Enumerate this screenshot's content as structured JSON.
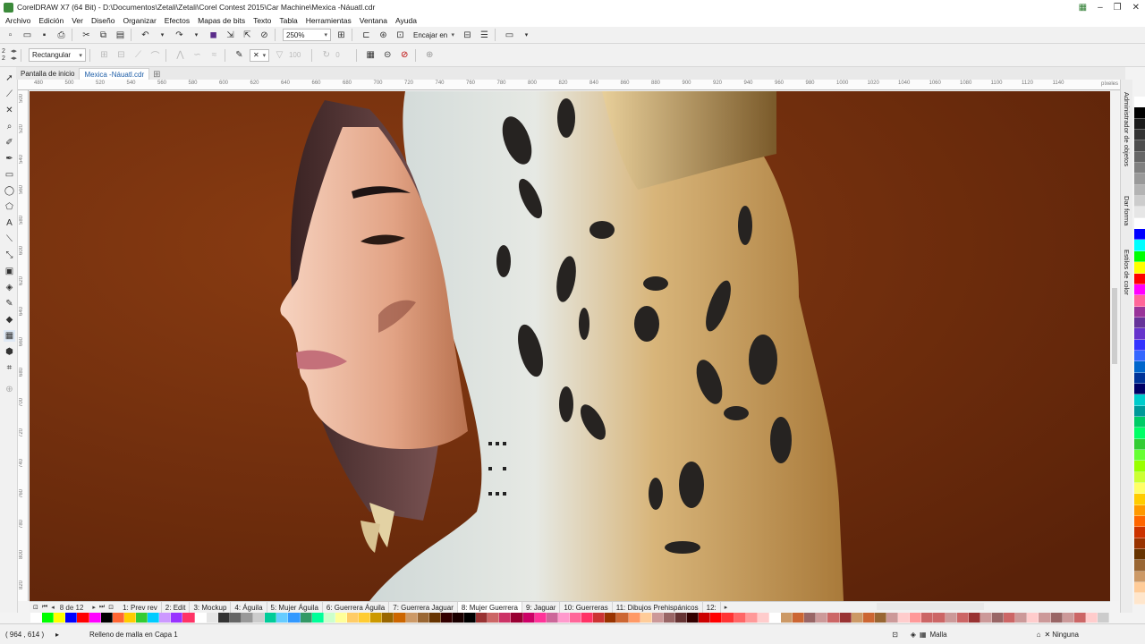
{
  "window": {
    "title": "CorelDRAW X7 (64 Bit) - D:\\Documentos\\Zetali\\Zetali\\Corel Contest 2015\\Car Machine\\Mexica -Náuatl.cdr"
  },
  "menu": [
    "Archivo",
    "Edición",
    "Ver",
    "Diseño",
    "Organizar",
    "Efectos",
    "Mapas de bits",
    "Texto",
    "Tabla",
    "Herramientas",
    "Ventana",
    "Ayuda"
  ],
  "toolbar": {
    "zoom": "250%",
    "snap_label": "Encajar en"
  },
  "propertybar": {
    "rows": "2",
    "cols": "2",
    "mode": "Rectangular",
    "transparency": "100",
    "angle": "0"
  },
  "doc_tabs": [
    "Pantalla de inicio",
    "Mexica -Náuatl.cdr"
  ],
  "active_doc_tab": 1,
  "ruler": {
    "unit": "píxeles",
    "h_ticks": [
      "480",
      "500",
      "520",
      "540",
      "560",
      "580",
      "600",
      "620",
      "640",
      "660",
      "680",
      "700",
      "720",
      "740",
      "760",
      "780",
      "800",
      "820",
      "840",
      "860",
      "880",
      "900",
      "920",
      "940",
      "960",
      "980",
      "1000",
      "1020",
      "1040",
      "1060",
      "1080",
      "1100",
      "1120",
      "1140"
    ],
    "v_ticks": [
      "500",
      "520",
      "540",
      "560",
      "580",
      "600",
      "620",
      "640",
      "660",
      "680",
      "700",
      "720",
      "740",
      "760",
      "780",
      "800",
      "820",
      "840"
    ]
  },
  "dockers": [
    "Administrador de objetos",
    "Dar forma",
    "Estilos de color"
  ],
  "pages": {
    "counter": "8 de 12",
    "tabs": [
      "1: Prev rev",
      "2: Edit",
      "3: Mockup",
      "4: Águila",
      "5: Mujer Águila",
      "6: Guerrera Águila",
      "7: Guerrera Jaguar",
      "8: Mujer Guerrera",
      "9: Jaguar",
      "10: Guerreras",
      "11: Dibujos Prehispánicos",
      "12:"
    ],
    "active": 7
  },
  "status": {
    "coords": "( 964 , 614 )",
    "message": "Relleno de malla en Capa 1",
    "fill": "Malla",
    "outline": "Ninguna"
  },
  "colors": {
    "canvas_bg": "#6b2a0d",
    "accent": "#1f5fa8"
  },
  "palette_right": [
    "#ffffff",
    "#000000",
    "#1a1a1a",
    "#333333",
    "#4d4d4d",
    "#666666",
    "#808080",
    "#999999",
    "#b3b3b3",
    "#cccccc",
    "#e6e6e6",
    "#ffffff",
    "#0000ff",
    "#00ffff",
    "#00ff00",
    "#ffff00",
    "#ff0000",
    "#ff00ff",
    "#ff6699",
    "#993399",
    "#663399",
    "#6633cc",
    "#3333ff",
    "#3366ff",
    "#0066cc",
    "#003399",
    "#000066",
    "#00cccc",
    "#009999",
    "#00cc66",
    "#00ff66",
    "#33cc33",
    "#66ff33",
    "#99ff00",
    "#ccff33",
    "#ffff66",
    "#ffcc00",
    "#ff9900",
    "#ff6600",
    "#cc3300",
    "#993300",
    "#663300",
    "#996633",
    "#cc9966",
    "#ffcc99",
    "#ffe6cc"
  ],
  "palette_bottom": [
    "#ffffff",
    "#00ff00",
    "#ffff00",
    "#0000ff",
    "#ff0000",
    "#ff00ff",
    "#000000",
    "#ff6633",
    "#ffcc00",
    "#33cc33",
    "#00ccff",
    "#cc99ff",
    "#9933ff",
    "#ff3366",
    "#ffffff",
    "#e6e6e6",
    "#333333",
    "#666666",
    "#999999",
    "#cccccc",
    "#00cc99",
    "#66ccff",
    "#3399ff",
    "#339966",
    "#00ff99",
    "#ccffcc",
    "#ffff99",
    "#ffcc66",
    "#ffcc33",
    "#cc9900",
    "#996600",
    "#cc6600",
    "#cc9966",
    "#996633",
    "#663300",
    "#330000",
    "#1a0000",
    "#000000",
    "#993333",
    "#cc6666",
    "#cc3366",
    "#990033",
    "#cc0066",
    "#ff3399",
    "#cc6699",
    "#ff99cc",
    "#ff6699",
    "#ff3366",
    "#cc3333",
    "#993300",
    "#cc6633",
    "#ff9966",
    "#ffcc99",
    "#cc9999",
    "#996666",
    "#663333",
    "#330000",
    "#cc0000",
    "#ff0000",
    "#ff3333",
    "#ff6666",
    "#ff9999",
    "#ffcccc",
    "#ffffff",
    "#cc9966",
    "#cc6633",
    "#996666",
    "#cc9999",
    "#cc6666",
    "#993333",
    "#cc9966",
    "#cc6633",
    "#996633",
    "#cc9999",
    "#ffcccc",
    "#ff9999",
    "#cc6666",
    "#cc6666",
    "#cc9999",
    "#cc6666",
    "#993333",
    "#cc9999",
    "#996666",
    "#cc6666",
    "#cc9999",
    "#ffcccc",
    "#cc9999",
    "#996666",
    "#cc9999",
    "#cc6666",
    "#ffcccc",
    "#cccccc"
  ]
}
